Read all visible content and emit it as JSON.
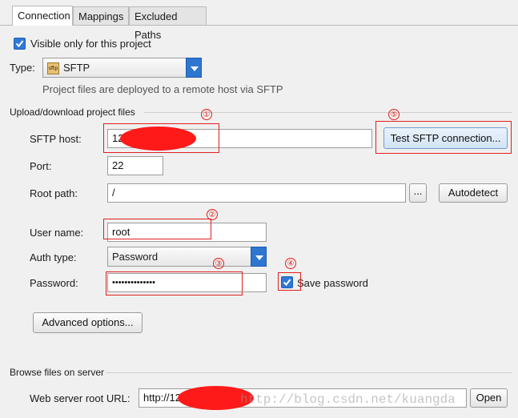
{
  "tabs": [
    {
      "label": "Connection",
      "active": true
    },
    {
      "label": "Mappings",
      "active": false
    },
    {
      "label": "Excluded Paths",
      "active": false
    }
  ],
  "visible_only": {
    "label": "Visible only for this project",
    "checked": true
  },
  "type": {
    "label": "Type:",
    "value": "SFTP",
    "icon": "sftp-icon",
    "hint": "Project files are deployed to a remote host via SFTP"
  },
  "upload_section": {
    "title": "Upload/download project files"
  },
  "sftp_host": {
    "label": "SFTP host:",
    "value": "12"
  },
  "test_button": {
    "label": "Test SFTP connection..."
  },
  "port": {
    "label": "Port:",
    "value": "22"
  },
  "root_path": {
    "label": "Root path:",
    "value": "/",
    "browse_label": "...",
    "autodetect_label": "Autodetect"
  },
  "user_name": {
    "label": "User name:",
    "value": "root"
  },
  "auth_type": {
    "label": "Auth type:",
    "value": "Password"
  },
  "password": {
    "label": "Password:",
    "value": "••••••••••••••",
    "save_label": "Save password",
    "save_checked": true
  },
  "advanced_button": {
    "label": "Advanced options..."
  },
  "browse_section": {
    "title": "Browse files on server"
  },
  "web_root": {
    "label": "Web server root URL:",
    "value": "http://12",
    "open_label": "Open"
  },
  "annotations": [
    "①",
    "②",
    "③",
    "④",
    "⑤"
  ],
  "watermark": "http://blog.csdn.net/kuangda",
  "colors": {
    "accent": "#2e76d0",
    "annotation": "#e0201d",
    "redaction": "#ff1a1a"
  }
}
